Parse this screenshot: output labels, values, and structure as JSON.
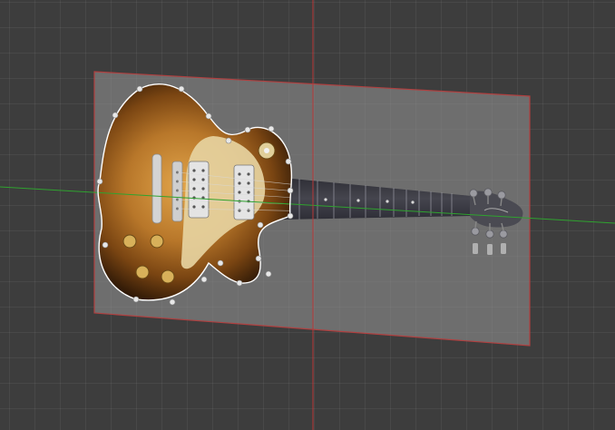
{
  "viewport": {
    "background_color": "#3d3d3d",
    "grid_color": "#4a4a4a",
    "x_axis_color": "#2fa32f",
    "y_axis_color": "#b83838"
  },
  "reference_image": {
    "subject": "electric guitar",
    "plane_color": "#8a8a8a",
    "plane_edge_color": "#b04040"
  },
  "selection": {
    "outline_color": "#ffffff",
    "vertex_color": "#e8e8e8"
  },
  "colors": {
    "sunburst_center": "#e2a54a",
    "sunburst_mid": "#9a5c1a",
    "sunburst_edge": "#2a1606",
    "pickguard": "#e6d3a0",
    "chrome": "#c8c8c8",
    "fretboard": "#3a3a44",
    "headstock": "#4a4a52"
  },
  "icons": {
    "vertex": "circle",
    "tuner": "circle"
  }
}
